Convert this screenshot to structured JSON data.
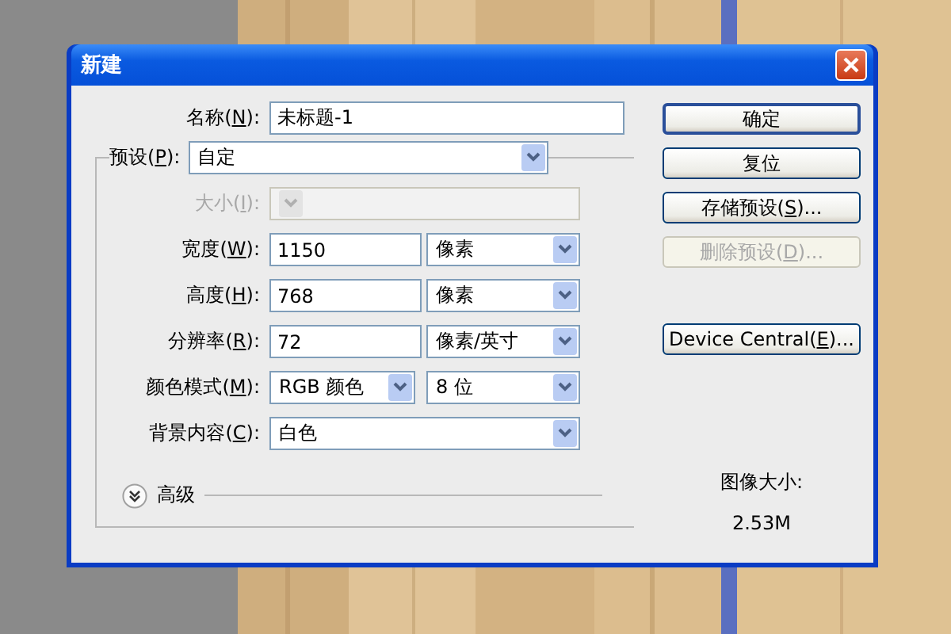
{
  "window": {
    "title": "新建"
  },
  "name": {
    "label": {
      "pre": "名称(",
      "key": "N",
      "post": "):"
    },
    "value": "未标题-1"
  },
  "preset": {
    "label": {
      "pre": "预设(",
      "key": "P",
      "post": "):"
    },
    "value": "自定"
  },
  "rows": [
    {
      "kind": "select",
      "disabled": true,
      "label": {
        "pre": "大小(",
        "key": "I",
        "post": "):"
      }
    },
    {
      "kind": "number-unit",
      "label": {
        "pre": "宽度(",
        "key": "W",
        "post": "):"
      },
      "value": "1150",
      "unit": "像素"
    },
    {
      "kind": "number-unit",
      "label": {
        "pre": "高度(",
        "key": "H",
        "post": "):"
      },
      "value": "768",
      "unit": "像素"
    },
    {
      "kind": "number-unit",
      "label": {
        "pre": "分辨率(",
        "key": "R",
        "post": "):"
      },
      "value": "72",
      "unit": "像素/英寸"
    },
    {
      "kind": "select-pair",
      "label": {
        "pre": "颜色模式(",
        "key": "M",
        "post": "):"
      },
      "value": "RGB 颜色",
      "unit": "8 位"
    },
    {
      "kind": "select",
      "disabled": false,
      "label": {
        "pre": "背景内容(",
        "key": "C",
        "post": "):"
      },
      "value": "白色"
    }
  ],
  "advanced": {
    "label": "高级",
    "expanded": false
  },
  "buttons": [
    {
      "pre": "确定",
      "default": true,
      "disabled": false
    },
    {
      "pre": "复位",
      "default": false,
      "disabled": false
    },
    {
      "pre": "存储预设(",
      "key": "S",
      "post": ")...",
      "default": false,
      "disabled": false
    },
    {
      "pre": "删除预设(",
      "key": "D",
      "post": ")...",
      "default": false,
      "disabled": true
    },
    {
      "pre": "Device Central(",
      "key": "E",
      "post": ")...",
      "default": false,
      "disabled": false
    }
  ],
  "image_size": {
    "label": "图像大小:",
    "value": "2.53M"
  }
}
